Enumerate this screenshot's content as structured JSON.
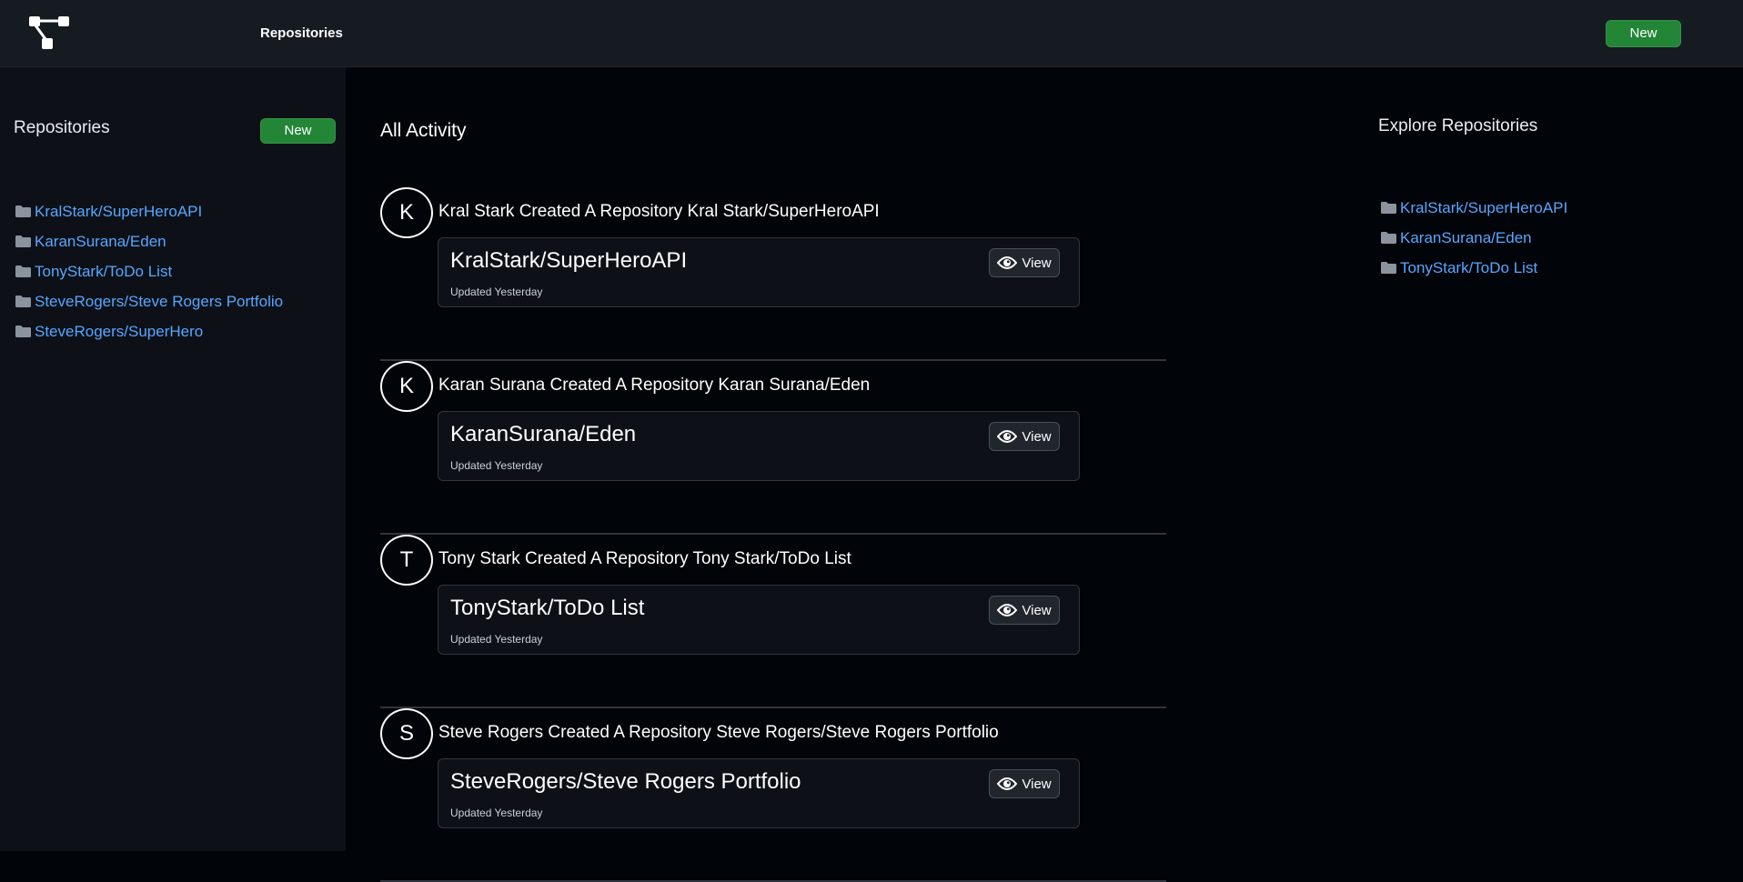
{
  "header": {
    "nav_label": "Repositories",
    "new_label": "New"
  },
  "sidebar": {
    "title": "Repositories",
    "new_label": "New",
    "repos": [
      "KralStark/SuperHeroAPI",
      "KaranSurana/Eden",
      "TonyStark/ToDo List",
      "SteveRogers/Steve Rogers Portfolio",
      "SteveRogers/SuperHero"
    ]
  },
  "main": {
    "title": "All Activity",
    "activities": [
      {
        "initial": "K",
        "text": "Kral Stark Created A Repository Kral Stark/SuperHeroAPI",
        "repo_name": "KralStark/SuperHeroAPI",
        "updated": "Updated Yesterday",
        "view_label": "View"
      },
      {
        "initial": "K",
        "text": "Karan Surana Created A Repository Karan Surana/Eden",
        "repo_name": "KaranSurana/Eden",
        "updated": "Updated Yesterday",
        "view_label": "View"
      },
      {
        "initial": "T",
        "text": "Tony Stark Created A Repository Tony Stark/ToDo List",
        "repo_name": "TonyStark/ToDo List",
        "updated": "Updated Yesterday",
        "view_label": "View"
      },
      {
        "initial": "S",
        "text": "Steve Rogers Created A Repository Steve Rogers/Steve Rogers Portfolio",
        "repo_name": "SteveRogers/Steve Rogers Portfolio",
        "updated": "Updated Yesterday",
        "view_label": "View"
      }
    ]
  },
  "explore": {
    "title": "Explore Repositories",
    "repos": [
      "KralStark/SuperHeroAPI",
      "KaranSurana/Eden",
      "TonyStark/ToDo List"
    ]
  },
  "icons": {
    "logo": "repository-tree-logo",
    "folder": "folder-icon",
    "view": "eye-icon"
  },
  "colors": {
    "header_bg": "#161b22",
    "sidebar_bg": "#0d1117",
    "page_bg": "#010409",
    "accent_green": "#238636",
    "link_blue": "#58a6ff"
  }
}
